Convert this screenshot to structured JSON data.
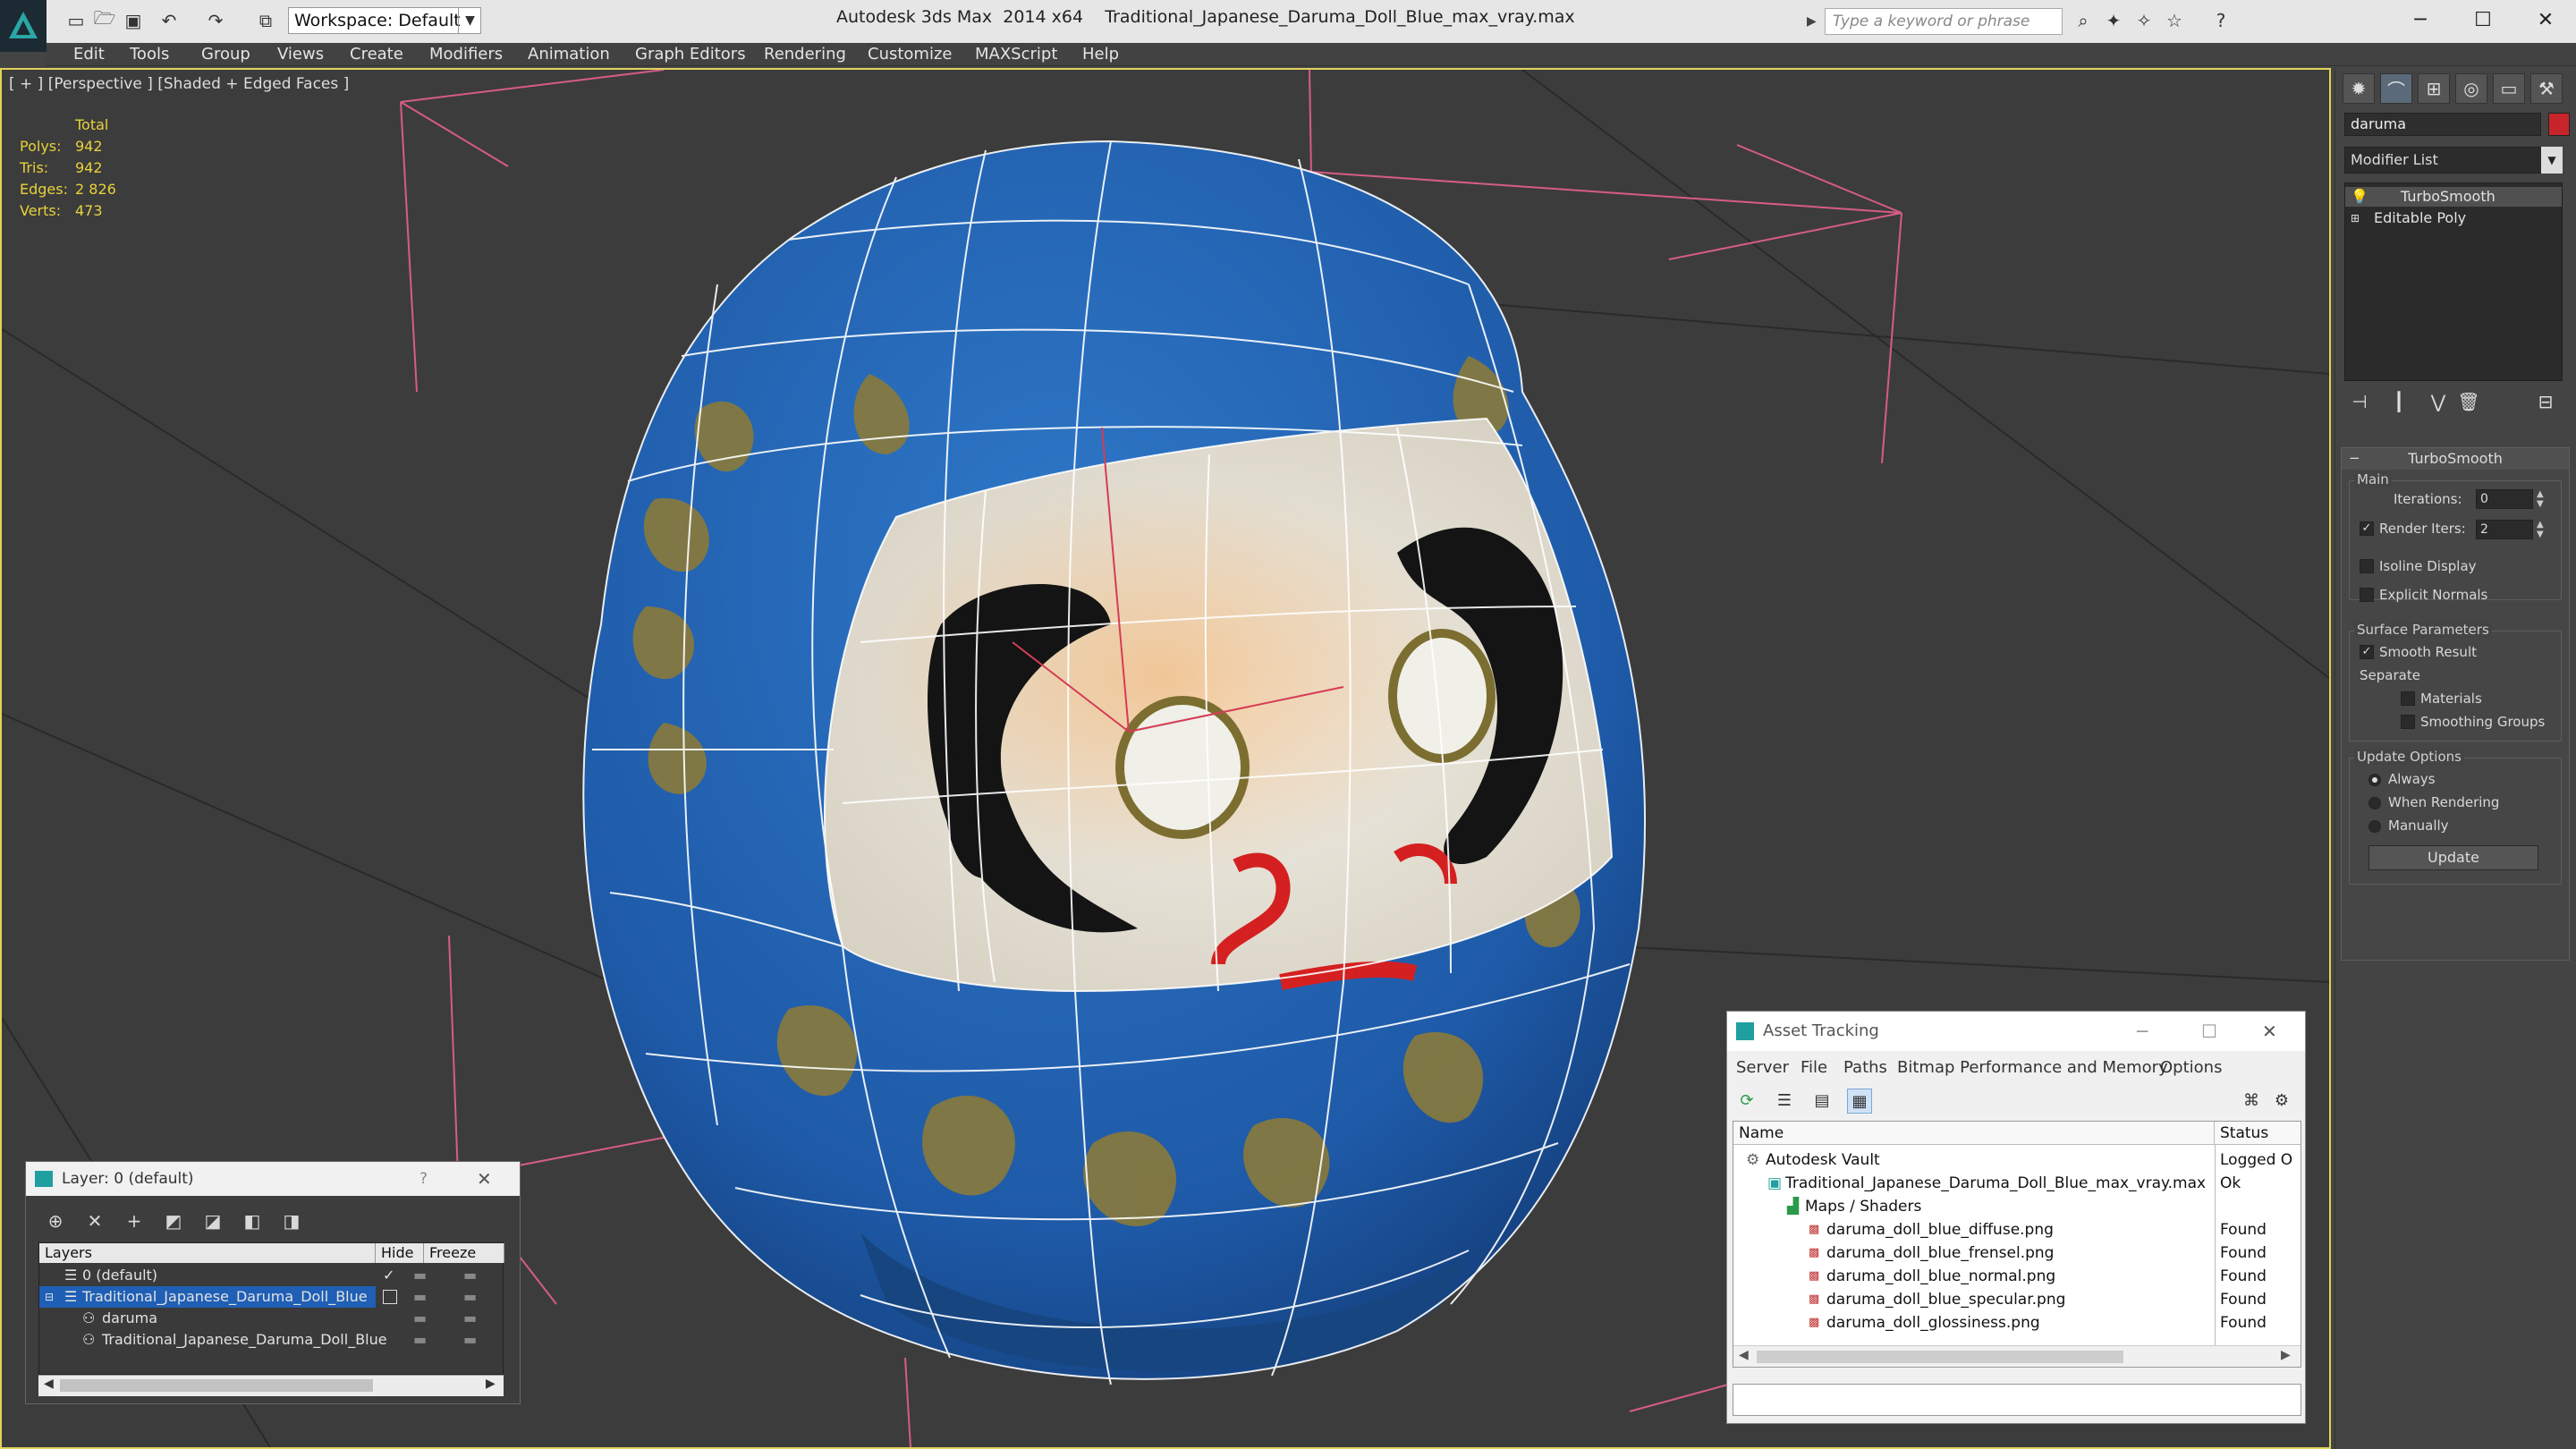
{
  "window": {
    "app_title": "Autodesk 3ds Max  2014 x64",
    "file_title": "Traditional_Japanese_Daruma_Doll_Blue_max_vray.max",
    "workspace_label": "Workspace: Default",
    "search_placeholder": "Type a keyword or phrase"
  },
  "menu": [
    "Edit",
    "Tools",
    "Group",
    "Views",
    "Create",
    "Modifiers",
    "Animation",
    "Graph Editors",
    "Rendering",
    "Customize",
    "MAXScript",
    "Help"
  ],
  "viewport": {
    "label": "[ + ] [Perspective ] [Shaded + Edged Faces ]",
    "stats_header": "Total",
    "stats": [
      {
        "label": "Polys:",
        "value": "942"
      },
      {
        "label": "Tris:",
        "value": "942"
      },
      {
        "label": "Edges:",
        "value": "2 826"
      },
      {
        "label": "Verts:",
        "value": "473"
      }
    ]
  },
  "command_panel": {
    "object_name": "daruma",
    "object_color": "#c8242c",
    "modifier_list": "Modifier List",
    "stack": [
      "TurboSmooth",
      "Editable Poly"
    ],
    "rollout": {
      "title": "TurboSmooth",
      "main_group": "Main",
      "iterations_label": "Iterations:",
      "iterations_value": "0",
      "render_iters_label": "Render Iters:",
      "render_iters_value": "2",
      "isoline": "Isoline Display",
      "explicit_normals": "Explicit Normals",
      "surface_group": "Surface Parameters",
      "smooth_result": "Smooth Result",
      "separate_label": "Separate",
      "materials": "Materials",
      "smoothing_groups": "Smoothing Groups",
      "update_group": "Update Options",
      "always": "Always",
      "when_rendering": "When Rendering",
      "manually": "Manually",
      "update_button": "Update"
    }
  },
  "layer_window": {
    "title": "Layer: 0 (default)",
    "help": "?",
    "columns": [
      "Layers",
      "Hide",
      "Freeze"
    ],
    "rows": [
      {
        "name": "0 (default)",
        "indent": 0
      },
      {
        "name": "Traditional_Japanese_Daruma_Doll_Blue",
        "indent": 0,
        "selected": true
      },
      {
        "name": "daruma",
        "indent": 1
      },
      {
        "name": "Traditional_Japanese_Daruma_Doll_Blue",
        "indent": 1
      }
    ]
  },
  "asset_window": {
    "title": "Asset Tracking",
    "menu": [
      "Server",
      "File",
      "Paths",
      "Bitmap Performance and Memory",
      "Options"
    ],
    "columns": [
      "Name",
      "Status"
    ],
    "rows": [
      {
        "name": "Autodesk Vault",
        "status": "Logged O",
        "indent": 0
      },
      {
        "name": "Traditional_Japanese_Daruma_Doll_Blue_max_vray.max",
        "status": "Ok",
        "indent": 1
      },
      {
        "name": "Maps / Shaders",
        "status": "",
        "indent": 2
      },
      {
        "name": "daruma_doll_blue_diffuse.png",
        "status": "Found",
        "indent": 3
      },
      {
        "name": "daruma_doll_blue_frensel.png",
        "status": "Found",
        "indent": 3
      },
      {
        "name": "daruma_doll_blue_normal.png",
        "status": "Found",
        "indent": 3
      },
      {
        "name": "daruma_doll_blue_specular.png",
        "status": "Found",
        "indent": 3
      },
      {
        "name": "daruma_doll_glossiness.png",
        "status": "Found",
        "indent": 3
      }
    ]
  },
  "colors": {
    "accent_blue": "#1f5fb5",
    "doll_blue": "#1e5aa8",
    "viewport_border": "#e0d35a",
    "stat_yellow": "#e6d23a"
  }
}
